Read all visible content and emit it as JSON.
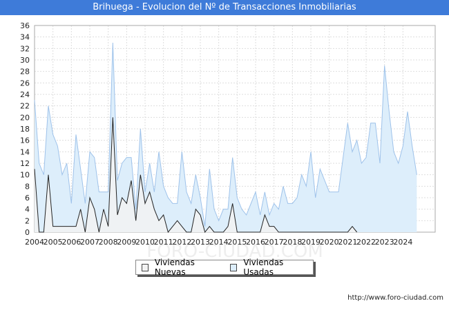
{
  "title": "Brihuega - Evolucion del Nº de Transacciones Inmobiliarias",
  "footer": "http://www.foro-ciudad.com",
  "watermark": "FORO-CIUDAD.COM",
  "colors": {
    "title_bg": "#3e7bd9",
    "usadas_fill": "#ddeefb",
    "usadas_line": "#9ec2ea",
    "nuevas_fill": "#f2f2f2",
    "nuevas_line": "#222222"
  },
  "chart_data": {
    "type": "area",
    "title": "Brihuega - Evolucion del Nº de Transacciones Inmobiliarias",
    "xlabel": "",
    "ylabel": "",
    "ylim": [
      0,
      36
    ],
    "yticks": [
      0,
      2,
      4,
      6,
      8,
      10,
      12,
      14,
      16,
      18,
      20,
      22,
      24,
      26,
      28,
      30,
      32,
      34,
      36
    ],
    "xticks": [
      "2004",
      "2005",
      "2006",
      "2007",
      "2008",
      "2009",
      "2010",
      "2011",
      "2012",
      "2013",
      "2014",
      "2015",
      "2016",
      "2017",
      "2018",
      "2019",
      "2020",
      "2021",
      "2022",
      "2023",
      "2024"
    ],
    "x_start": 2004,
    "points_per_year": 4,
    "grid": true,
    "legend_position": "bottom",
    "series": [
      {
        "name": "Viviendas Usadas",
        "values": [
          23,
          12,
          10,
          22,
          17,
          15,
          10,
          12,
          5,
          17,
          11,
          5,
          14,
          13,
          7,
          7,
          7,
          33,
          9,
          12,
          13,
          13,
          4,
          18,
          7,
          12,
          7,
          14,
          8,
          6,
          5,
          5,
          14,
          7,
          5,
          10,
          6,
          1,
          11,
          4,
          2,
          4,
          4,
          13,
          6,
          4,
          3,
          5,
          7,
          3,
          7,
          3,
          5,
          4,
          8,
          5,
          5,
          6,
          10,
          8,
          14,
          6,
          11,
          9,
          7,
          7,
          7,
          13,
          19,
          14,
          16,
          12,
          13,
          19,
          19,
          12,
          29,
          21,
          14,
          12,
          15,
          21,
          15,
          10
        ]
      },
      {
        "name": "Viviendas Nuevas",
        "values": [
          11,
          0,
          0,
          10,
          1,
          1,
          1,
          1,
          1,
          1,
          4,
          0,
          6,
          4,
          0,
          4,
          1,
          20,
          3,
          6,
          5,
          9,
          2,
          10,
          5,
          7,
          4,
          2,
          3,
          0,
          1,
          2,
          1,
          0,
          0,
          4,
          3,
          0,
          1,
          0,
          0,
          0,
          1,
          5,
          0,
          0,
          0,
          0,
          0,
          0,
          3,
          1,
          1,
          0,
          0,
          0,
          0,
          0,
          0,
          0,
          0,
          0,
          0,
          0,
          0,
          0,
          0,
          0,
          0,
          1,
          0,
          0,
          0,
          0,
          0,
          0,
          0,
          0,
          0,
          0,
          0,
          0,
          0,
          0
        ]
      }
    ]
  }
}
